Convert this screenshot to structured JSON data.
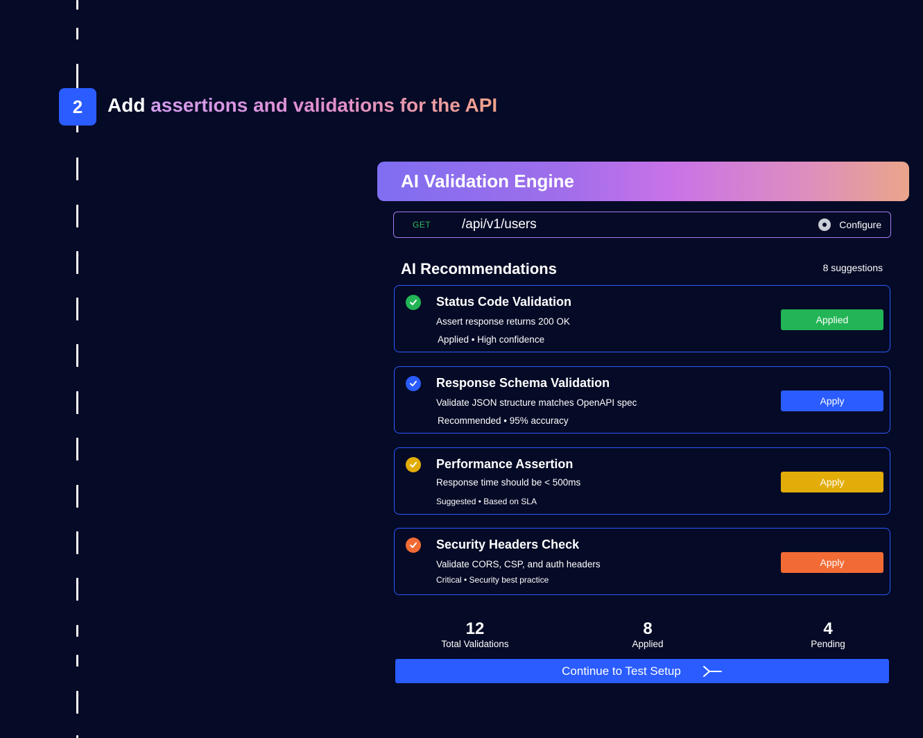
{
  "step": {
    "number": "2",
    "title_plain": "Add",
    "title_highlight": "assertions and validations for the API"
  },
  "engine": {
    "title": "AI Validation Engine"
  },
  "endpoint": {
    "method": "GET",
    "path": "/api/v1/users",
    "configure_label": "Configure",
    "configure_icon": "gear-icon"
  },
  "recommendations": {
    "title": "AI Recommendations",
    "count_label": "8 suggestions",
    "items": [
      {
        "title": "Status Code Validation",
        "description": "Assert response returns 200 OK",
        "meta": "Applied • High confidence",
        "button": "Applied",
        "color": "#22b455"
      },
      {
        "title": "Response Schema Validation",
        "description": "Validate JSON structure matches OpenAPI spec",
        "meta": "Recommended • 95% accuracy",
        "button": "Apply",
        "color": "#2a5cff"
      },
      {
        "title": "Performance Assertion",
        "description": "Response time should be < 500ms",
        "meta": "Suggested • Based on SLA",
        "button": "Apply",
        "color": "#e2ad09"
      },
      {
        "title": "Security Headers Check",
        "description": "Validate CORS, CSP, and auth headers",
        "meta": "Critical • Security best practice",
        "button": "Apply",
        "color": "#f26b35"
      }
    ]
  },
  "stats": [
    {
      "value": "12",
      "label": "Total Validations"
    },
    {
      "value": "8",
      "label": "Applied"
    },
    {
      "value": "4",
      "label": "Pending"
    }
  ],
  "continue_label": "Continue to Test Setup",
  "continue_icon": "arrow-right-icon"
}
